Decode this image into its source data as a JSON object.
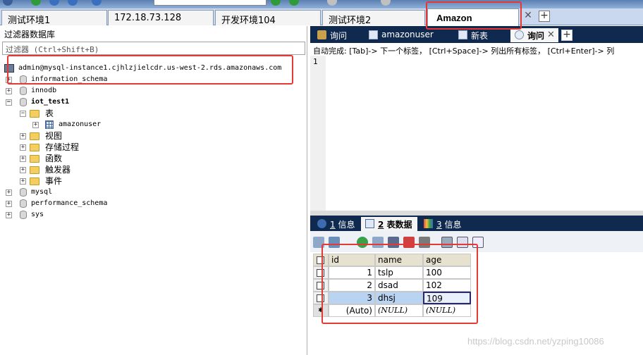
{
  "connection_tabs": [
    {
      "label": "测试环境1",
      "active": false
    },
    {
      "label": "172.18.73.128",
      "active": false
    },
    {
      "label": "开发环境104",
      "active": false
    },
    {
      "label": "测试环境2",
      "active": false
    },
    {
      "label": "Amazon",
      "active": true
    }
  ],
  "left_panel": {
    "title": "过滤器数据库",
    "filter_placeholder": "过滤器 (Ctrl+Shift+B)",
    "server": "admin@mysql-instance1.cjhlzjielcdr.us-west-2.rds.amazonaws.com",
    "tree": [
      {
        "label": "information_schema",
        "kind": "db",
        "expanded": false
      },
      {
        "label": "innodb",
        "kind": "db",
        "expanded": false
      },
      {
        "label": "iot_test1",
        "kind": "db",
        "expanded": true
      },
      {
        "label": "表",
        "kind": "folder",
        "expanded": true
      },
      {
        "label": "amazonuser",
        "kind": "table"
      },
      {
        "label": "视图",
        "kind": "folder"
      },
      {
        "label": "存储过程",
        "kind": "folder"
      },
      {
        "label": "函数",
        "kind": "folder"
      },
      {
        "label": "触发器",
        "kind": "folder"
      },
      {
        "label": "事件",
        "kind": "folder"
      },
      {
        "label": "mysql",
        "kind": "db"
      },
      {
        "label": "performance_schema",
        "kind": "db"
      },
      {
        "label": "sys",
        "kind": "db"
      }
    ]
  },
  "editor_tabs": [
    {
      "label": "询问",
      "active": false
    },
    {
      "label": "amazonuser",
      "active": false
    },
    {
      "label": "新表",
      "active": false
    },
    {
      "label": "询问",
      "active": true
    }
  ],
  "editor": {
    "hint": "自动完成: [Tab]-> 下一个标签， [Ctrl+Space]-> 列出所有标签， [Ctrl+Enter]-> 列",
    "line_number": "1"
  },
  "result_tabs": [
    {
      "num": "1",
      "label": "信息",
      "active": false
    },
    {
      "num": "2",
      "label": "表数据",
      "active": true
    },
    {
      "num": "3",
      "label": "信息",
      "active": false
    }
  ],
  "grid": {
    "columns": [
      "id",
      "name",
      "age"
    ],
    "rows": [
      [
        "1",
        "tslp",
        "100"
      ],
      [
        "2",
        "dsad",
        "102"
      ],
      [
        "3",
        "dhsj",
        "109"
      ]
    ],
    "new_row": [
      "(Auto)",
      "(NULL)",
      "(NULL)"
    ]
  },
  "watermark": "https://blog.csdn.net/yzping10086",
  "colors": {
    "annotation": "#e53935",
    "tab_strip": "#10294f",
    "selection": "#b9d4f3"
  }
}
